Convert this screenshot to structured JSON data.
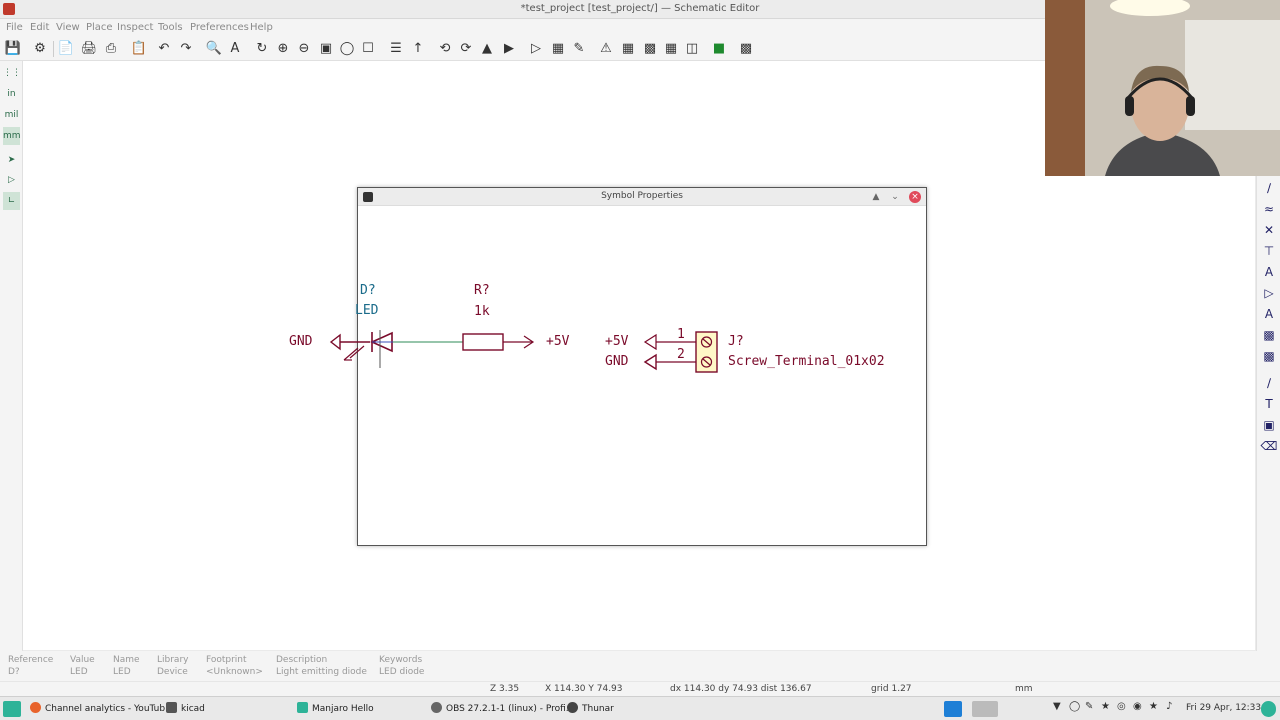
{
  "window": {
    "title": "*test_project [test_project/] — Schematic Editor"
  },
  "menu": [
    "File",
    "Edit",
    "View",
    "Place",
    "Inspect",
    "Tools",
    "Preferences",
    "Help"
  ],
  "left_toolbar": [
    "in",
    "mil",
    "mm"
  ],
  "dialog": {
    "title": "Symbol Properties"
  },
  "schematic": {
    "led_ref": "D?",
    "led_value": "LED",
    "resistor_ref": "R?",
    "resistor_value": "1k",
    "gnd_left": "GND",
    "plus5v_right": "+5V",
    "plus5v_conn": "+5V",
    "gnd_conn": "GND",
    "pin1": "1",
    "pin2": "2",
    "conn_ref": "J?",
    "conn_value": "Screw_Terminal_01x02"
  },
  "message_panel": {
    "reference": {
      "label": "Reference",
      "value": "D?"
    },
    "value": {
      "label": "Value",
      "value": "LED"
    },
    "name": {
      "label": "Name",
      "value": "LED"
    },
    "library": {
      "label": "Library",
      "value": "Device"
    },
    "footprint": {
      "label": "Footprint",
      "value": "<Unknown>"
    },
    "description": {
      "label": "Description",
      "value": "Light emitting diode"
    },
    "keywords": {
      "label": "Keywords",
      "value": "LED diode"
    }
  },
  "status": {
    "zoom": "Z 3.35",
    "cursor": "X 114.30  Y 74.93",
    "delta": "dx 114.30  dy 74.93  dist 136.67",
    "grid": "grid 1.27",
    "units": "mm"
  },
  "taskbar": {
    "items": [
      "Channel analytics - YouTub...",
      "kicad",
      "Manjaro Hello",
      "OBS 27.2.1-1 (linux) - Profi...",
      "Thunar"
    ],
    "clock": "Fri 29 Apr, 12:33"
  },
  "colors": {
    "wire": "#2e8b57",
    "symbol": "#7a0a2a",
    "reference": "#1a6b8a",
    "symbol_fill": "#fff7c7"
  }
}
